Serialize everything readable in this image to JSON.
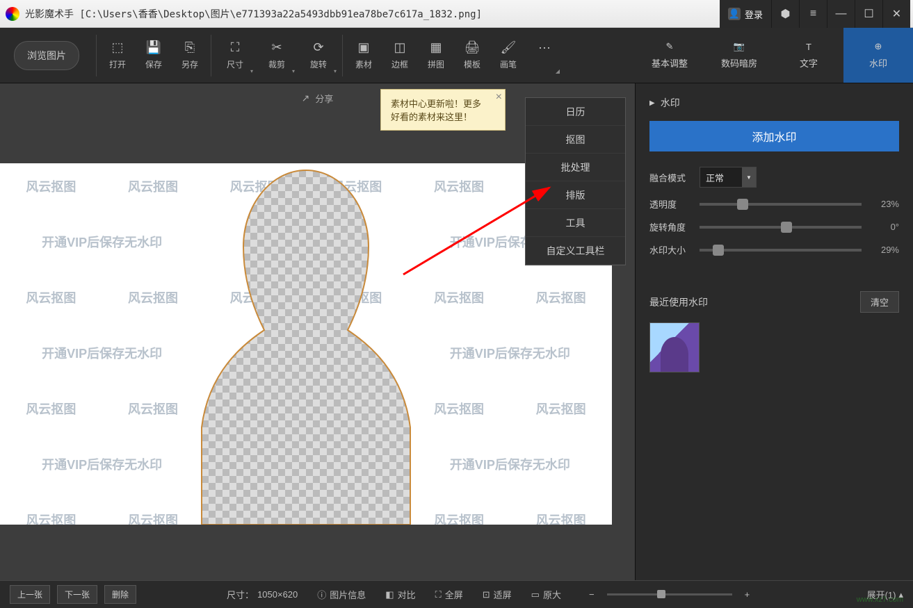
{
  "title": "光影魔术手  [C:\\Users\\香香\\Desktop\\图片\\e771393a22a5493dbb91ea78be7c617a_1832.png]",
  "login": "登录",
  "browse": "浏览图片",
  "tools": {
    "open": "打开",
    "save": "保存",
    "saveas": "另存",
    "size": "尺寸",
    "crop": "裁剪",
    "rotate": "旋转",
    "material": "素材",
    "border": "边框",
    "collage": "拼图",
    "template": "模板",
    "brush": "画笔"
  },
  "rtools": {
    "basic": "基本调整",
    "darkroom": "数码暗房",
    "text": "文字",
    "watermark": "水印"
  },
  "share": "分享",
  "tooltip": {
    "line1": "素材中心更新啦！更多",
    "line2": "好看的素材来这里！"
  },
  "dropdown": [
    "日历",
    "抠图",
    "批处理",
    "排版",
    "工具",
    "自定义工具栏"
  ],
  "panel": {
    "title": "水印",
    "add": "添加水印",
    "blend_label": "融合模式",
    "blend_value": "正常",
    "opacity_label": "透明度",
    "opacity_value": "23%",
    "rotate_label": "旋转角度",
    "rotate_value": "0°",
    "size_label": "水印大小",
    "size_value": "29%",
    "recent_label": "最近使用水印",
    "clear": "清空"
  },
  "canvas": {
    "wm1": "风云抠图",
    "wm2": "开通VIP后保存无水印"
  },
  "status": {
    "prev": "上一张",
    "next": "下一张",
    "delete": "删除",
    "dim_label": "尺寸：",
    "dim_value": "1050×620",
    "info": "图片信息",
    "compare": "对比",
    "full": "全屏",
    "fit": "适屏",
    "orig": "原大",
    "expand": "展开(1)"
  },
  "footer_wm": "www.xz7.com"
}
